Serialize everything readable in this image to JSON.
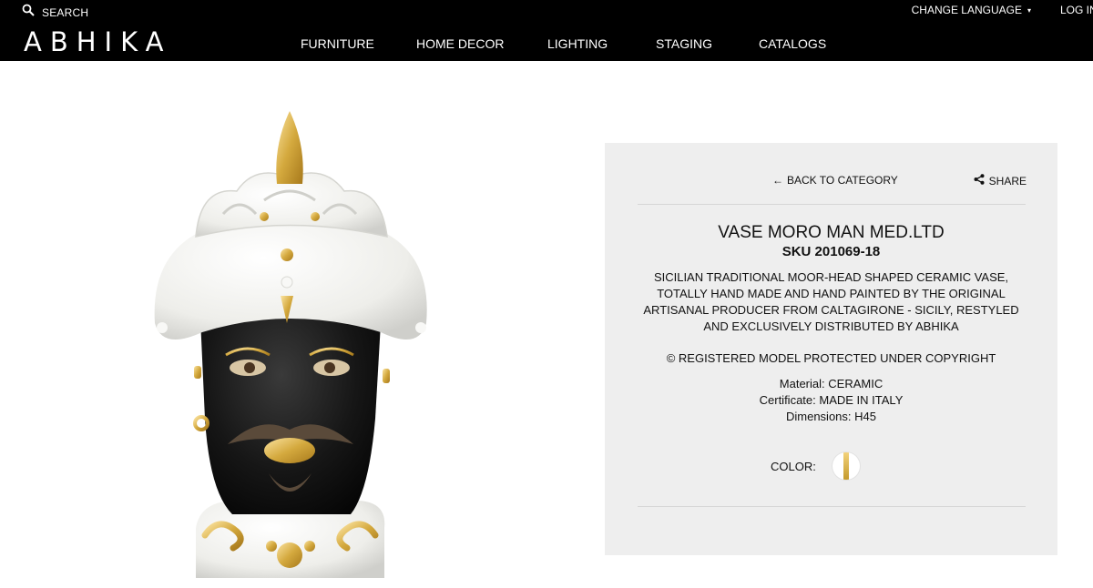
{
  "header": {
    "search_label": "SEARCH",
    "language_label": "CHANGE LANGUAGE",
    "language_caret": "▾",
    "login_label": "LOG IN",
    "logo_text": "ABHIKA",
    "nav": [
      "FURNITURE",
      "HOME DECOR",
      "LIGHTING",
      "STAGING",
      "CATALOGS"
    ]
  },
  "product": {
    "back_label": "BACK TO CATEGORY",
    "back_arrow": "←",
    "share_label": "SHARE",
    "title": "VASE MORO MAN MED.LTD",
    "sku": "SKU 201069-18",
    "description": "SICILIAN TRADITIONAL MOOR-HEAD SHAPED CERAMIC VASE, TOTALLY HAND MADE AND HAND PAINTED BY THE ORIGINAL ARTISANAL PRODUCER FROM CALTAGIRONE - SICILY, RESTYLED AND EXCLUSIVELY DISTRIBUTED BY ABHIKA",
    "copyright": "© REGISTERED MODEL PROTECTED UNDER COPYRIGHT",
    "specs": {
      "material_label": "Material:",
      "material_value": "CERAMIC",
      "certificate_label": "Certificate:",
      "certificate_value": "MADE IN ITALY",
      "dimensions_label": "Dimensions:",
      "dimensions_value": "H45"
    },
    "color_label": "COLOR:",
    "color_swatch": "white-gold"
  },
  "colors": {
    "header_bg": "#000000",
    "panel_bg": "#eeeeee",
    "gold": "#d4a93e",
    "ceramic_black": "#141414",
    "ceramic_white": "#f4f4f2"
  }
}
